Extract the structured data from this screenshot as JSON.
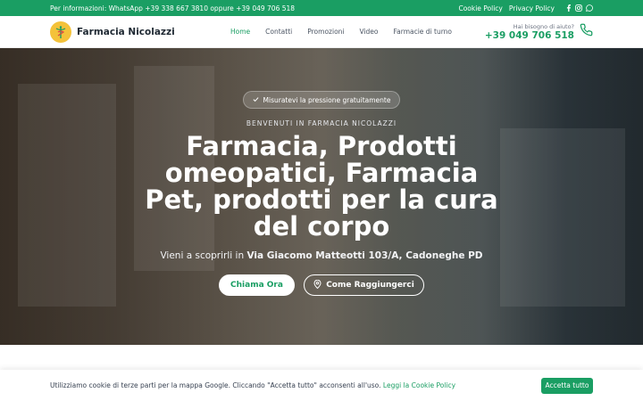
{
  "topbar": {
    "info": "Per informazioni: WhatsApp +39 338 667 3810 oppure +39 049 706 518",
    "links": [
      "Cookie Policy",
      "Privacy Policy"
    ],
    "social_icons": [
      "facebook-icon",
      "instagram-icon",
      "whatsapp-icon"
    ]
  },
  "header": {
    "logo_name": "Farmacia Nicolazzi",
    "nav": [
      "Home",
      "Contatti",
      "Promozioni",
      "Video",
      "Farmacie di turno"
    ],
    "active_nav": "Home",
    "help_label": "Hai bisogno di aiuto?",
    "help_phone": "+39 049 706 518"
  },
  "hero": {
    "pill": "Misuratevi la pressione gratuitamente",
    "welcome": "BENVENUTI IN FARMACIA NICOLAZZI",
    "title": "Farmacia, Prodotti omeopatici, Farmacia Pet, prodotti per la cura del corpo",
    "subtitle_prefix": "Vieni a scoprirli in",
    "subtitle_address": "Via Giacomo Matteotti 103/A, Cadoneghe PD",
    "button_call": "Chiama Ora",
    "button_directions": "Come Raggiungerci"
  },
  "cookie": {
    "text": "Utilizziamo cookie di terze parti per la mappa Google. Cliccando \"Accetta tutto\" acconsenti all'uso.",
    "link": "Leggi la Cookie Policy",
    "accept": "Accetta tutto"
  },
  "colors": {
    "accent": "#1a9e63",
    "logo": "#f4c23a"
  }
}
